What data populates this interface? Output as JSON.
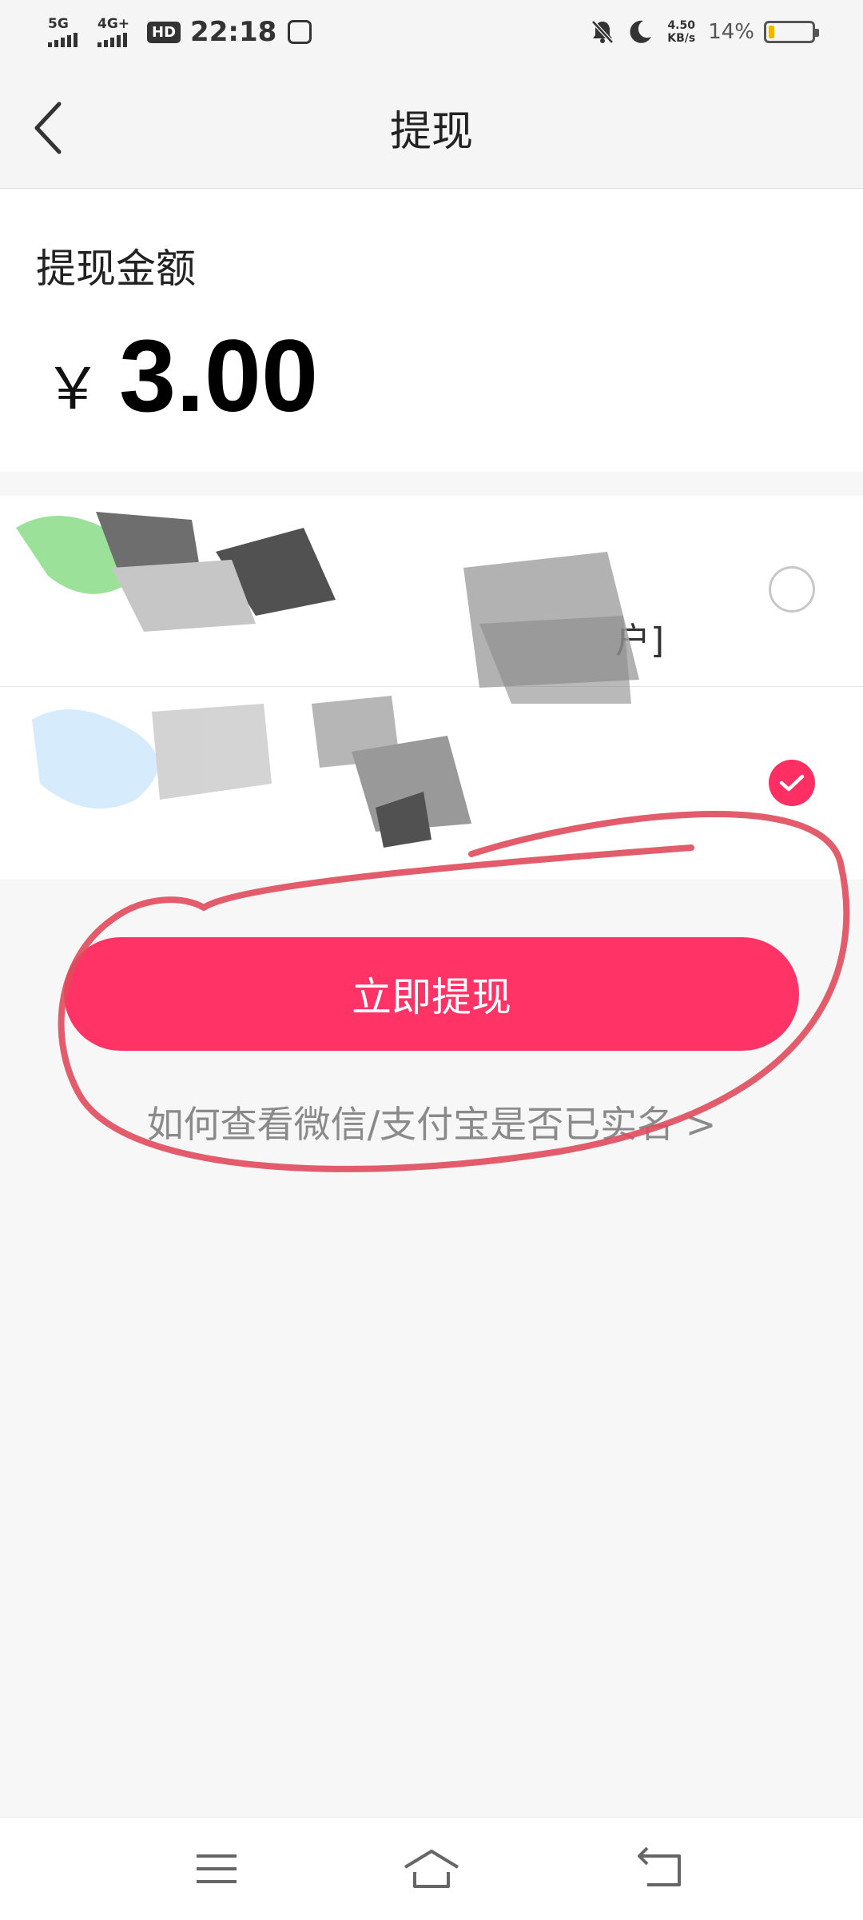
{
  "status_bar": {
    "signal1_label": "5G",
    "signal2_label": "4G+",
    "hd_label": "HD",
    "time": "22:18",
    "speed_value": "4.50",
    "speed_unit": "KB/s",
    "battery_percent": "14%",
    "battery_level": 0.14
  },
  "nav": {
    "title": "提现"
  },
  "amount_section": {
    "label": "提现金额",
    "currency": "￥",
    "amount": "3.00"
  },
  "methods": [
    {
      "hint": "户]",
      "selected": false
    },
    {
      "hint": "",
      "selected": true
    }
  ],
  "action": {
    "withdraw_label": "立即提现",
    "help_text": "如何查看微信/支付宝是否已实名 >"
  },
  "colors": {
    "accent": "#ff3366",
    "annotation": "#e04a5c"
  }
}
